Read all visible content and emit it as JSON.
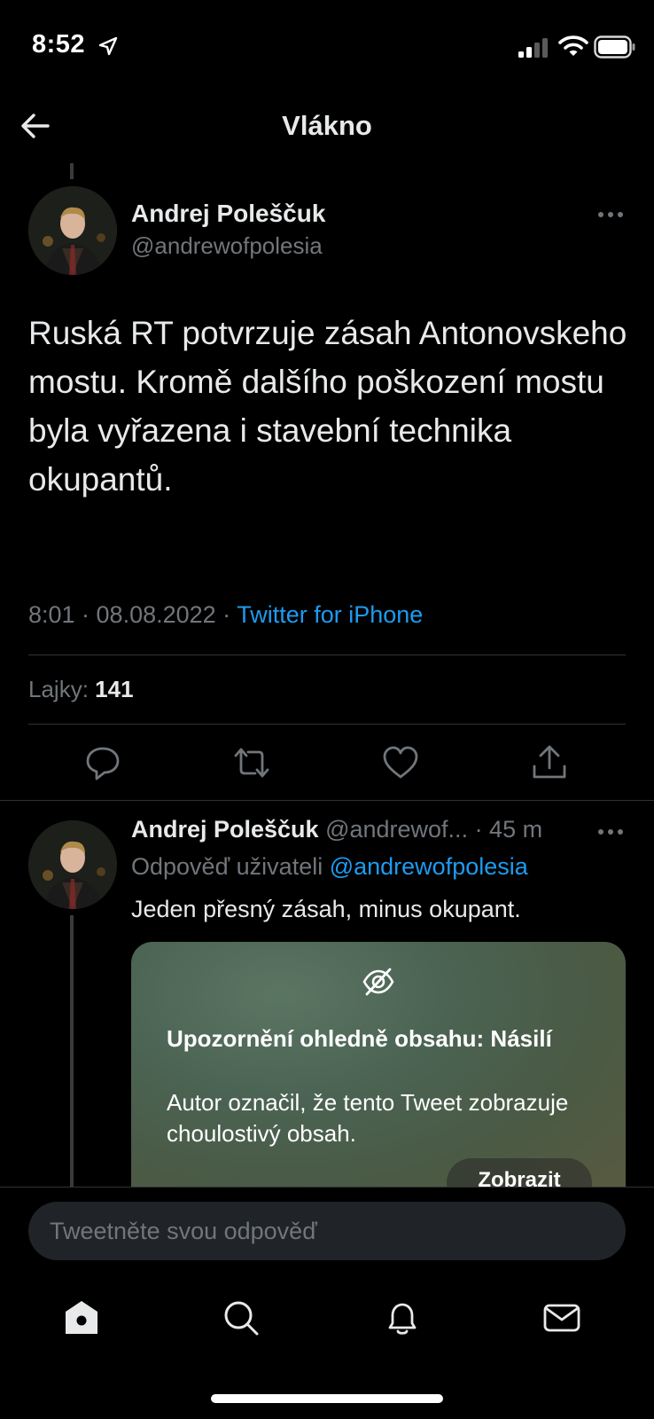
{
  "status_bar": {
    "time": "8:52"
  },
  "header": {
    "title": "Vlákno"
  },
  "tweet": {
    "author_name": "Andrej Poleščuk",
    "author_handle": "@andrewofpolesia",
    "text": "Ruská RT potvrzuje zásah Antonovskeho mostu. Kromě dalšího poškození mostu byla vyřazena i stavební technika okupantů.",
    "time": "8:01 · 08.08.2022 · ",
    "source": "Twitter for iPhone",
    "likes_label": "Lajky: ",
    "likes_count": "141"
  },
  "reply": {
    "author_name": "Andrej Poleščuk",
    "author_handle_time": " @andrewof... · 45 m",
    "reply_to_label": "Odpověď uživateli ",
    "reply_to_handle": "@andrewofpolesia",
    "text": "Jeden přesný zásah, minus okupant.",
    "warning": {
      "title": "Upozornění ohledně obsahu: Násilí",
      "body": "Autor označil, že tento Tweet zobrazuje choulostivý obsah.",
      "button": "Zobrazit"
    }
  },
  "composer": {
    "placeholder": "Tweetněte svou odpověď"
  },
  "colors": {
    "accent": "#1d9bf0",
    "background": "#000000",
    "muted": "#71767b"
  },
  "icons": {
    "header": "back-arrow-icon",
    "actions": [
      "reply-icon",
      "retweet-icon",
      "like-icon",
      "share-icon"
    ],
    "tabs": [
      "home-icon",
      "search-icon",
      "notifications-icon",
      "messages-icon"
    ]
  }
}
